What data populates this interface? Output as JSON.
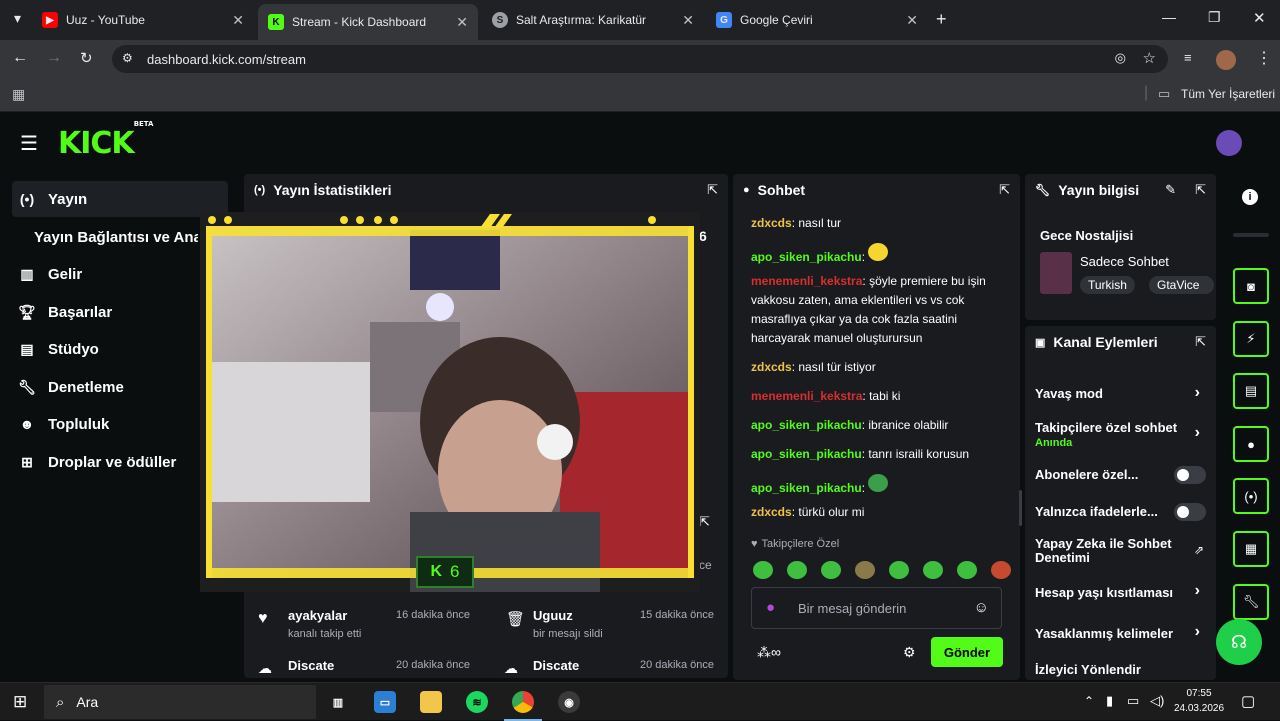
{
  "browser": {
    "tabs": [
      {
        "title": "Uuz - YouTube",
        "favicon": "youtube-icon",
        "active": false
      },
      {
        "title": "Stream - Kick Dashboard",
        "favicon": "kick-icon",
        "active": true
      },
      {
        "title": "Salt Araştırma: Karikatür",
        "favicon": "salt-icon",
        "active": false
      },
      {
        "title": "Google Çeviri",
        "favicon": "translate-icon",
        "active": false
      }
    ],
    "url": "dashboard.kick.com/stream",
    "bookmarks_label": "Tüm Yer İşaretleri"
  },
  "kick": {
    "logo": "KICK",
    "logo_badge": "BETA",
    "accent": "#53fc18"
  },
  "sidebar": {
    "items": [
      {
        "label": "Yayın",
        "icon": "broadcast-icon",
        "active": true
      },
      {
        "label": "Yayın Bağlantısı ve Ana",
        "icon": "",
        "active": false
      },
      {
        "label": "Gelir",
        "icon": "chart-icon",
        "active": false
      },
      {
        "label": "Başarılar",
        "icon": "trophy-icon",
        "active": false
      },
      {
        "label": "Stüdyo",
        "icon": "studio-icon",
        "active": false
      },
      {
        "label": "Denetleme",
        "icon": "wrench-icon",
        "active": false
      },
      {
        "label": "Topluluk",
        "icon": "community-icon",
        "active": false
      },
      {
        "label": "Droplar ve ödüller",
        "icon": "gift-icon",
        "active": false
      }
    ]
  },
  "stats": {
    "title": "Yayın İstatistikleri",
    "value_right": "6"
  },
  "activity": [
    {
      "user": "ayakyalar",
      "action": "kanalı takip etti",
      "time": "16 dakika önce",
      "icon": "heart-icon"
    },
    {
      "user": "Uguuz",
      "action": "bir mesajı sildi",
      "time": "15 dakika önce",
      "icon": "trash-icon"
    },
    {
      "user": "Discate",
      "action": "",
      "time": "20 dakika önce",
      "icon": "cloud-icon"
    },
    {
      "user": "Discate",
      "action": "",
      "time": "20 dakika önce",
      "icon": "cloud-icon"
    }
  ],
  "activity_side_label": "ce",
  "overlay": {
    "badge_count": "6"
  },
  "chat": {
    "title": "Sohbet",
    "messages": [
      {
        "user": "zdxcds",
        "color": "yellow",
        "text": "nasıl tur"
      },
      {
        "user": "apo_siken_pikachu",
        "color": "green",
        "text": ""
      },
      {
        "user": "menemenli_kekstra",
        "color": "red",
        "text": "şöyle premiere bu işin vakkosu zaten, ama eklentileri vs vs cok masraflıya çıkar ya da cok fazla saatini harcayarak manuel oluşturursun"
      },
      {
        "user": "zdxcds",
        "color": "yellow",
        "text": "nasıl tür istiyor"
      },
      {
        "user": "menemenli_kekstra",
        "color": "red",
        "text": "tabi ki"
      },
      {
        "user": "apo_siken_pikachu",
        "color": "green",
        "text": "ibranice olabilir"
      },
      {
        "user": "apo_siken_pikachu",
        "color": "green",
        "text": "tanrı israili korusun"
      },
      {
        "user": "apo_siken_pikachu",
        "color": "green",
        "text": ""
      },
      {
        "user": "zdxcds",
        "color": "yellow",
        "text": "türkü olur mi"
      }
    ],
    "followers_only": "Takipçilere Özel",
    "placeholder": "Bir mesaj gönderin",
    "send": "Gönder"
  },
  "stream_info": {
    "title": "Yayın bilgisi",
    "stream_title": "Gece Nostaljisi",
    "category": "Sadece Sohbet",
    "tags": [
      "Turkish",
      "GtaVice"
    ]
  },
  "channel_actions": {
    "title": "Kanal Eylemleri",
    "items": [
      {
        "label": "Yavaş mod",
        "sub": "",
        "control": "chevron"
      },
      {
        "label": "Takipçilere özel sohbet",
        "sub": "Anında",
        "control": "chevron"
      },
      {
        "label": "Abonelere özel...",
        "sub": "",
        "control": "toggle"
      },
      {
        "label": "Yalnızca ifadelerle...",
        "sub": "",
        "control": "toggle"
      },
      {
        "label": "Yapay Zeka ile Sohbet Denetimi",
        "sub": "",
        "control": "external"
      },
      {
        "label": "Hesap yaşı kısıtlaması",
        "sub": "",
        "control": "chevron"
      },
      {
        "label": "Yasaklanmış kelimeler",
        "sub": "",
        "control": "chevron"
      },
      {
        "label": "İzleyici Yönlendir",
        "sub": "",
        "control": "none"
      }
    ]
  },
  "taskbar": {
    "search": "Ara",
    "time": "07:55",
    "date": "24.03.2026"
  }
}
